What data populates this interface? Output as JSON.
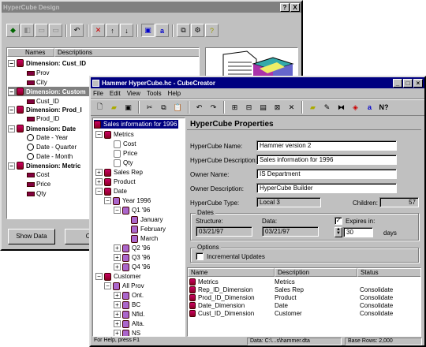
{
  "design": {
    "title": "HyperCube Design",
    "title_buttons": [
      "?",
      "X"
    ],
    "columns": {
      "names": "Names",
      "descriptions": "Descriptions"
    },
    "dimensions": [
      {
        "label": "Dimension: Cust_ID",
        "fields": [
          "Prov",
          "City"
        ]
      },
      {
        "label": "Dimension: Custom",
        "fields": [
          "Cust_ID"
        ]
      },
      {
        "label": "Dimension: Prod_I",
        "fields": [
          "Prod_ID"
        ]
      },
      {
        "label": "Dimension: Date",
        "fields": [
          "Date - Year",
          "Date - Quarter",
          "Date - Month"
        ]
      },
      {
        "label": "Dimension: Metric",
        "fields": [
          "Cost",
          "Price",
          "Qty"
        ]
      }
    ],
    "show_data_label": "Show Data",
    "cancel_label": "Ca"
  },
  "cube": {
    "title": "Hammer HyperCube.hc - CubeCreator",
    "menu": [
      "File",
      "Edit",
      "View",
      "Tools",
      "Help"
    ],
    "tree": {
      "root": "Sales information for 1996",
      "metrics": "Metrics",
      "metric_items": [
        "Cost",
        "Price",
        "Qty"
      ],
      "sales_rep": "Sales Rep",
      "product": "Product",
      "date": "Date",
      "year": "Year 1996",
      "q1": "Q1 '96",
      "months": [
        "January",
        "February",
        "March"
      ],
      "quarters": [
        "Q2 '96",
        "Q3 '96",
        "Q4 '96"
      ],
      "customer": "Customer",
      "all_prov": "All Prov",
      "provinces": [
        "Ont.",
        "BC",
        "Nfld.",
        "Alta.",
        "NS"
      ]
    },
    "properties": {
      "heading": "HyperCube Properties",
      "name_label": "HyperCube Name:",
      "name_value": "Hammer version 2",
      "desc_label": "HyperCube Description:",
      "desc_value": "Sales information for 1996",
      "owner_label": "Owner Name:",
      "owner_value": "IS Department",
      "owner_desc_label": "Owner Description:",
      "owner_desc_value": "HyperCube Builder",
      "type_label": "HyperCube Type:",
      "type_value": "Local 3",
      "children_label": "Children:",
      "children_value": "57",
      "dates_group": "Dates",
      "structure_label": "Structure:",
      "structure_value": "03/21/97",
      "data_label": "Data:",
      "data_value": "03/21/97",
      "expires_label": "Expires in:",
      "expires_checked": true,
      "expires_value": "30",
      "days_label": "days",
      "options_group": "Options",
      "incremental_label": "Incremental Updates",
      "incremental_checked": false
    },
    "list": {
      "headers": [
        "Name",
        "Description",
        "Status"
      ],
      "rows": [
        {
          "name": "Metrics",
          "desc": "Metrics",
          "status": ""
        },
        {
          "name": "Rep_ID_Dimension",
          "desc": "Sales Rep",
          "status": "Consolidate"
        },
        {
          "name": "Prod_ID_Dimension",
          "desc": "Product",
          "status": "Consolidate"
        },
        {
          "name": "Date_Dimension",
          "desc": "Date",
          "status": "Consolidate"
        },
        {
          "name": "Cust_ID_Dimension",
          "desc": "Customer",
          "status": "Consolidate"
        }
      ]
    },
    "status": {
      "help": "For Help, press F1",
      "data": "Data:   C:\\...s\\hammer.dta",
      "rows": "Base Rows:   2,000"
    }
  }
}
